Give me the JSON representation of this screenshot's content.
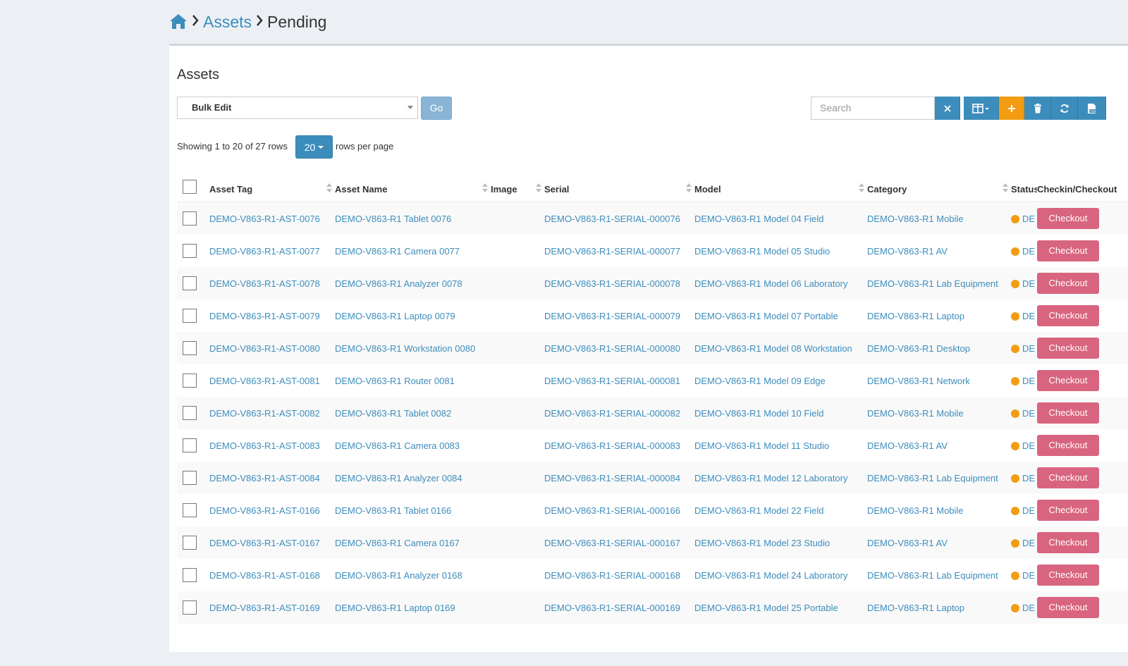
{
  "breadcrumb": {
    "home_icon": "home-icon",
    "assets": "Assets",
    "pending": "Pending"
  },
  "panel": {
    "title": "Assets"
  },
  "toolbar": {
    "bulk_select_value": "Bulk Edit",
    "go_label": "Go",
    "search_placeholder": "Search",
    "icons": [
      "clear-icon",
      "columns-icon",
      "plus-icon",
      "trash-icon",
      "refresh-icon",
      "export-csv-icon"
    ]
  },
  "pagination": {
    "info": "Showing 1 to 20 of 27 rows",
    "per_page": "20",
    "per_page_suffix": "rows per page"
  },
  "table": {
    "headers": {
      "asset_tag": "Asset Tag",
      "asset_name": "Asset Name",
      "image": "Image",
      "serial": "Serial",
      "model": "Model",
      "category": "Category",
      "status": "Status",
      "checkin": "Checkin/Checkout"
    },
    "rows": [
      {
        "tag": "DEMO-V863-R1-AST-0076",
        "name": "DEMO-V863-R1 Tablet 0076",
        "serial": "DEMO-V863-R1-SERIAL-000076",
        "model": "DEMO-V863-R1 Model 04 Field",
        "category": "DEMO-V863-R1 Mobile",
        "status": "DE",
        "action": "Checkout"
      },
      {
        "tag": "DEMO-V863-R1-AST-0077",
        "name": "DEMO-V863-R1 Camera 0077",
        "serial": "DEMO-V863-R1-SERIAL-000077",
        "model": "DEMO-V863-R1 Model 05 Studio",
        "category": "DEMO-V863-R1 AV",
        "status": "DE",
        "action": "Checkout"
      },
      {
        "tag": "DEMO-V863-R1-AST-0078",
        "name": "DEMO-V863-R1 Analyzer 0078",
        "serial": "DEMO-V863-R1-SERIAL-000078",
        "model": "DEMO-V863-R1 Model 06 Laboratory",
        "category": "DEMO-V863-R1 Lab Equipment",
        "status": "DE",
        "action": "Checkout"
      },
      {
        "tag": "DEMO-V863-R1-AST-0079",
        "name": "DEMO-V863-R1 Laptop 0079",
        "serial": "DEMO-V863-R1-SERIAL-000079",
        "model": "DEMO-V863-R1 Model 07 Portable",
        "category": "DEMO-V863-R1 Laptop",
        "status": "DE",
        "action": "Checkout"
      },
      {
        "tag": "DEMO-V863-R1-AST-0080",
        "name": "DEMO-V863-R1 Workstation 0080",
        "serial": "DEMO-V863-R1-SERIAL-000080",
        "model": "DEMO-V863-R1 Model 08 Workstation",
        "category": "DEMO-V863-R1 Desktop",
        "status": "DE",
        "action": "Checkout"
      },
      {
        "tag": "DEMO-V863-R1-AST-0081",
        "name": "DEMO-V863-R1 Router 0081",
        "serial": "DEMO-V863-R1-SERIAL-000081",
        "model": "DEMO-V863-R1 Model 09 Edge",
        "category": "DEMO-V863-R1 Network",
        "status": "DE",
        "action": "Checkout"
      },
      {
        "tag": "DEMO-V863-R1-AST-0082",
        "name": "DEMO-V863-R1 Tablet 0082",
        "serial": "DEMO-V863-R1-SERIAL-000082",
        "model": "DEMO-V863-R1 Model 10 Field",
        "category": "DEMO-V863-R1 Mobile",
        "status": "DE",
        "action": "Checkout"
      },
      {
        "tag": "DEMO-V863-R1-AST-0083",
        "name": "DEMO-V863-R1 Camera 0083",
        "serial": "DEMO-V863-R1-SERIAL-000083",
        "model": "DEMO-V863-R1 Model 11 Studio",
        "category": "DEMO-V863-R1 AV",
        "status": "DE",
        "action": "Checkout"
      },
      {
        "tag": "DEMO-V863-R1-AST-0084",
        "name": "DEMO-V863-R1 Analyzer 0084",
        "serial": "DEMO-V863-R1-SERIAL-000084",
        "model": "DEMO-V863-R1 Model 12 Laboratory",
        "category": "DEMO-V863-R1 Lab Equipment",
        "status": "DE",
        "action": "Checkout"
      },
      {
        "tag": "DEMO-V863-R1-AST-0166",
        "name": "DEMO-V863-R1 Tablet 0166",
        "serial": "DEMO-V863-R1-SERIAL-000166",
        "model": "DEMO-V863-R1 Model 22 Field",
        "category": "DEMO-V863-R1 Mobile",
        "status": "DE",
        "action": "Checkout"
      },
      {
        "tag": "DEMO-V863-R1-AST-0167",
        "name": "DEMO-V863-R1 Camera 0167",
        "serial": "DEMO-V863-R1-SERIAL-000167",
        "model": "DEMO-V863-R1 Model 23 Studio",
        "category": "DEMO-V863-R1 AV",
        "status": "DE",
        "action": "Checkout"
      },
      {
        "tag": "DEMO-V863-R1-AST-0168",
        "name": "DEMO-V863-R1 Analyzer 0168",
        "serial": "DEMO-V863-R1-SERIAL-000168",
        "model": "DEMO-V863-R1 Model 24 Laboratory",
        "category": "DEMO-V863-R1 Lab Equipment",
        "status": "DE",
        "action": "Checkout"
      },
      {
        "tag": "DEMO-V863-R1-AST-0169",
        "name": "DEMO-V863-R1 Laptop 0169",
        "serial": "DEMO-V863-R1-SERIAL-000169",
        "model": "DEMO-V863-R1 Model 25 Portable",
        "category": "DEMO-V863-R1 Laptop",
        "status": "DE",
        "action": "Checkout"
      }
    ]
  },
  "colors": {
    "link": "#3c8dbc",
    "primary": "#3c8dbc",
    "warning": "#f39c12",
    "checkout": "#d9647f",
    "status_dot": "#f39c12"
  }
}
